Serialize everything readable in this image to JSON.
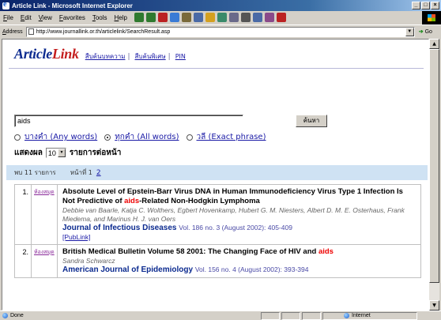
{
  "window": {
    "title": "Article Link - Microsoft Internet Explorer"
  },
  "menu": [
    "File",
    "Edit",
    "View",
    "Favorites",
    "Tools",
    "Help"
  ],
  "address": {
    "label": "Address",
    "url": "http://www.journallink.or.th/articlelink/SearchResult.asp",
    "go": "Go"
  },
  "status": {
    "text": "Done",
    "zone": "Internet"
  },
  "page": {
    "logo_article": "Article",
    "logo_link": "Link",
    "nav": [
      "สืบค้นบทความ",
      "สืบค้นพิเศษ",
      "PIN"
    ],
    "search_value": "aids",
    "search_button": "ค้นหา",
    "radios": [
      {
        "label": "บางคำ (Any words)",
        "checked": false
      },
      {
        "label": "ทุกคำ (All words)",
        "checked": true
      },
      {
        "label": "วลี (Exact phrase)",
        "checked": false
      }
    ],
    "show_label": "แสดงผล",
    "per_page_value": "10",
    "per_page_suffix": "รายการต่อหน้า",
    "found_text": "พบ 11 รายการ",
    "page_label": "หน้าที่ 1",
    "page_link": "2"
  },
  "results": [
    {
      "num": "1.",
      "library": "ห้องสมุด",
      "title_pre": "Absolute Level of Epstein-Barr Virus DNA in Human Immunodeficiency Virus Type 1 Infection Is Not Predictive of ",
      "title_hl": "aids",
      "title_post": "-Related Non-Hodgkin Lymphoma",
      "authors": "Debbie van Baarle, Katja C. Wolthers, Egbert Hovenkamp, Hubert G. M. Niesters, Albert D. M. E. Osterhaus, Frank Miedema, and Marinus H. J. van Oers",
      "journal": "Journal of Infectious Diseases",
      "vol": "Vol. 186 no. 3 (August 2002): 405-409",
      "publink": "[PubLink]"
    },
    {
      "num": "2.",
      "library": "ห้องสมุด",
      "title_pre": "British Medical Bulletin Volume 58 2001: The Changing Face of HIV and ",
      "title_hl": "aids",
      "title_post": "",
      "authors": "Sandra Schwarcz",
      "journal": "American Journal of Epidemiology",
      "vol": "Vol. 156 no. 4 (August 2002): 393-394",
      "publink": ""
    }
  ]
}
